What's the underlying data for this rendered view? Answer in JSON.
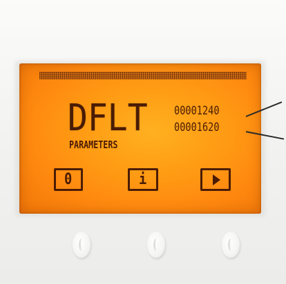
{
  "screen": {
    "mode_title": "DFLT",
    "mode_subtitle": "PARAMETERS",
    "counters": [
      "00001240",
      "00001620"
    ]
  },
  "softkeys": [
    {
      "label": "0",
      "icon": "zero-key-icon"
    },
    {
      "label": "i",
      "icon": "info-icon"
    },
    {
      "label": "",
      "icon": "play-arrow-icon"
    }
  ],
  "colors": {
    "lcd_backlight": "#ff9d14",
    "lcd_segment": "#4a1c05",
    "device_body": "#f3f3f1"
  }
}
